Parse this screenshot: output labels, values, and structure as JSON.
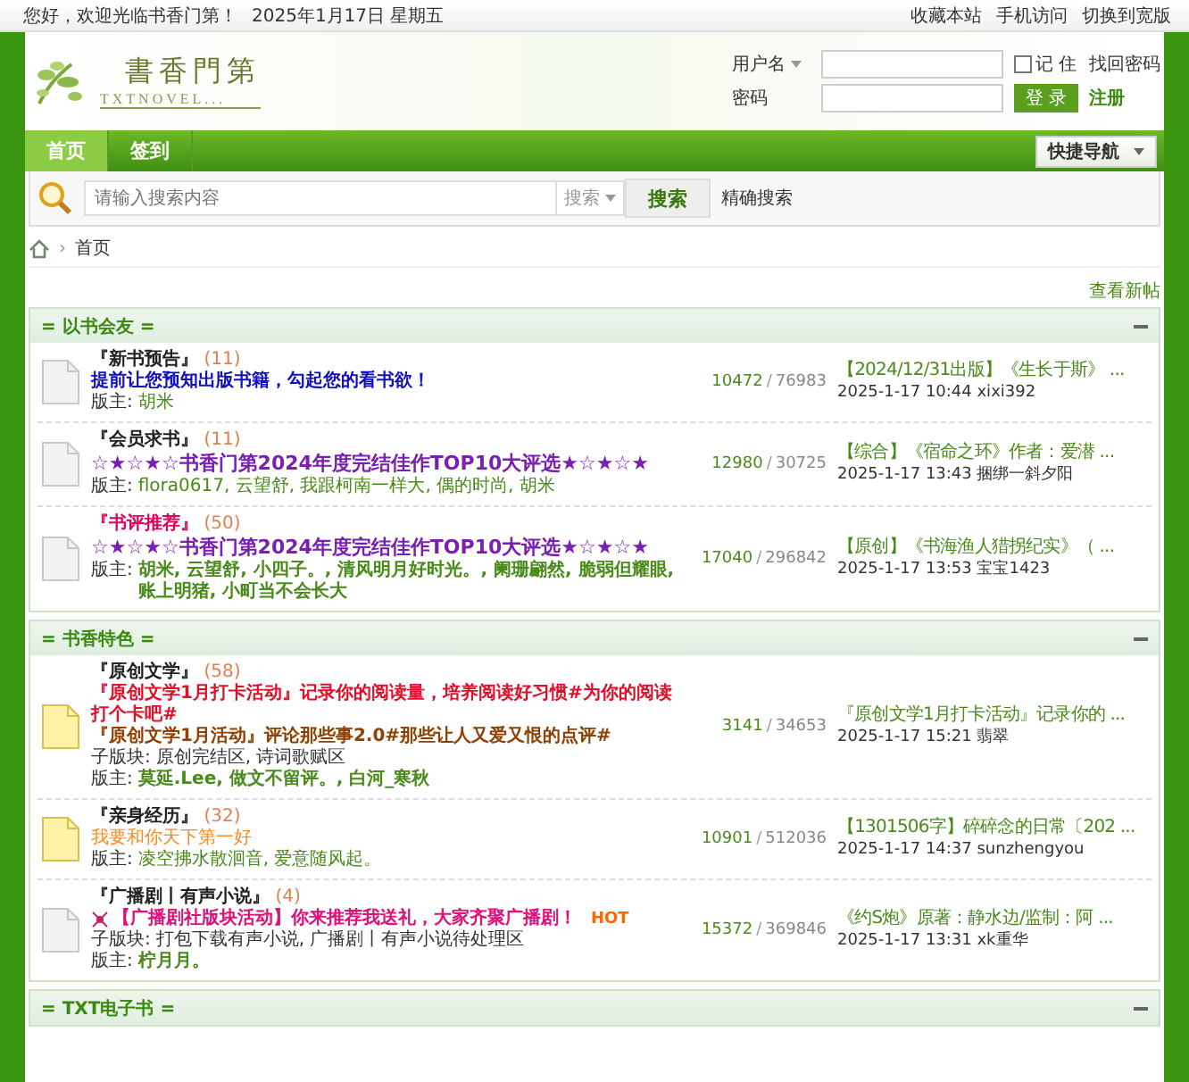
{
  "top_bar": {
    "welcome": "您好，欢迎光临书香门第！",
    "date": "2025年1月17日 星期五",
    "links": [
      "收藏本站",
      "手机访问",
      "切换到宽版"
    ]
  },
  "logo": {
    "title": "書香門第",
    "subtitle": "TXTNOVEL..."
  },
  "login": {
    "username_label": "用户名",
    "remember_label": "记 住",
    "remember_checked": false,
    "recover_link": "找回密码",
    "password_label": "密码",
    "login_button": "登 录",
    "register_link": "注册"
  },
  "nav": {
    "tabs": [
      {
        "label": "首页",
        "selected": true
      },
      {
        "label": "签到",
        "selected": false
      }
    ],
    "quick_nav": "快捷导航"
  },
  "search": {
    "placeholder": "请输入搜索内容",
    "type": "搜索",
    "button": "搜索",
    "precise_link": "精确搜索"
  },
  "breadcrumb": {
    "separator": "›",
    "current": "首页"
  },
  "new_posts_link": "查看新帖",
  "sections": [
    {
      "title": "= 以书会友 =",
      "forums": [
        {
          "name": "『新书预告』",
          "name_highlighted": false,
          "count": "(11)",
          "has_new": false,
          "lines": [
            {
              "kind": "notice",
              "text": "提前让您预知出版书籍，勾起您的看书欲！"
            }
          ],
          "moderators_label": "版主:",
          "moderators": "胡米",
          "moderators_bold": false,
          "topics": "10472",
          "stats_separator": "/",
          "posts": "76983",
          "last_title": "【2024/12/31出版】《生长于斯》 ...",
          "last_meta": "2025-1-17 10:44 xixi392"
        },
        {
          "name": "『会员求书』",
          "name_highlighted": false,
          "count": "(11)",
          "has_new": false,
          "lines": [
            {
              "kind": "award",
              "text": "☆★☆★☆书香门第2024年度完结佳作TOP10大评选★☆★☆★"
            }
          ],
          "moderators_label": "版主:",
          "moderators": "flora0617, 云望舒, 我跟柯南一样大, 偶的时尚, 胡米",
          "moderators_bold": false,
          "topics": "12980",
          "stats_separator": "/",
          "posts": "30725",
          "last_title": "【综合】《宿命之环》作者：爱潜 ...",
          "last_meta": "2025-1-17 13:43 捆绑一斜夕阳"
        },
        {
          "name": "『书评推荐』",
          "name_highlighted": true,
          "count": "(50)",
          "has_new": false,
          "lines": [
            {
              "kind": "award",
              "text": "☆★☆★☆书香门第2024年度完结佳作TOP10大评选★☆★☆★"
            }
          ],
          "moderators_label": "版主:",
          "moderators": "胡米, 云望舒, 小四子。, 清风明月好时光。, 阑珊翩然, 脆弱但耀眼, 账上明猪, 小町当不会长大",
          "moderators_bold": true,
          "topics": "17040",
          "stats_separator": "/",
          "posts": "296842",
          "last_title": "【原创】《书海渔人猎拐纪实》（ ...",
          "last_meta": "2025-1-17 13:53 宝宝1423"
        }
      ]
    },
    {
      "title": "= 书香特色 =",
      "forums": [
        {
          "name": "『原创文学』",
          "name_highlighted": false,
          "count": "(58)",
          "has_new": true,
          "lines": [
            {
              "kind": "event",
              "text": "『原创文学1月打卡活动』记录你的阅读量，培养阅读好习惯#为你的阅读打个卡吧#"
            },
            {
              "kind": "review",
              "text": "『原创文学1月活动』评论那些事2.0#那些让人又爱又恨的点评#"
            }
          ],
          "subforums_label": "子版块:",
          "subforums": "原创完结区, 诗词歌赋区",
          "moderators_label": "版主:",
          "moderators": "莫延.Lee, 做文不留评。, 白河_寒秋",
          "moderators_bold": true,
          "topics": "3141",
          "stats_separator": "/",
          "posts": "34653",
          "last_title": "『原创文学1月打卡活动』记录你的 ...",
          "last_meta": "2025-1-17 15:21 翡翠"
        },
        {
          "name": "『亲身经历』",
          "name_highlighted": false,
          "count": "(32)",
          "has_new": true,
          "lines": [
            {
              "kind": "plain",
              "text": "我要和你天下第一好"
            }
          ],
          "moderators_label": "版主:",
          "moderators": "凌空拂水散洄音, 爱意随风起。",
          "moderators_bold": false,
          "topics": "10901",
          "stats_separator": "/",
          "posts": "512036",
          "last_title": "【1301506字】碎碎念的日常〔202 ...",
          "last_meta": "2025-1-17 14:37 sunzhengyou"
        },
        {
          "name": "『广播剧丨有声小说』",
          "name_highlighted": false,
          "count": "(4)",
          "has_new": false,
          "lines": [
            {
              "kind": "promo",
              "text": "【广播剧社版块活动】你来推荐我送礼，大家齐聚广播剧！",
              "icon": true,
              "hot_label": "HOT"
            }
          ],
          "subforums_label": "子版块:",
          "subforums": "打包下载有声小说, 广播剧丨有声小说待处理区",
          "moderators_label": "版主:",
          "moderators": "柠月月。",
          "moderators_bold": true,
          "topics": "15372",
          "stats_separator": "/",
          "posts": "369846",
          "last_title": "《约S炮》原著：静水边/监制：阿 ...",
          "last_meta": "2025-1-17 13:31 xk重华"
        }
      ]
    },
    {
      "title": "= TXT电子书 ="
    }
  ]
}
